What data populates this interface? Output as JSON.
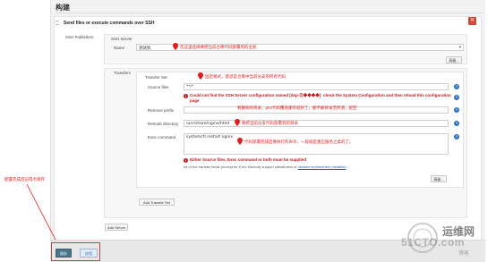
{
  "section": {
    "title": "构建"
  },
  "step": {
    "title": "Send files or execute commands over SSH",
    "close": "✕",
    "publishers_label": "SSH Publishers"
  },
  "ssh_server": {
    "header": "SSH Server",
    "name_label": "Name",
    "name_value": "测试机",
    "advanced": "高级..."
  },
  "transfers": {
    "label": "Transfers",
    "set_header": "Transfer Set",
    "source_files": {
      "label": "Source files",
      "value": "**/*"
    },
    "error_config": "Could not find the SSH Server configuration named [dsp-云◆◆◆◆]- check the System Configuration and then reload this configuration page",
    "remove_prefix": {
      "label": "Remove prefix",
      "value": ""
    },
    "remote_directory": {
      "label": "Remote directory",
      "value": "/usr/share/nginx/html"
    },
    "exec_command": {
      "label": "Exec command",
      "value": "systemctl restart nginx"
    },
    "error_either": "Either Source files, Exec command or both must be supplied",
    "note_prefix": "All of the transfer fields (except for Exec timeout) support substitution of",
    "note_link": "Jenkins environment variables",
    "advanced": "高级...",
    "add_transfer_set": "Add Transfer Set",
    "add_server": "Add Server"
  },
  "annotations": {
    "server": "在这里选择要把当前仓库代码部署到的主机",
    "source": "固定格式，意思是仓库中当前分支的所有代码",
    "prefix": "要删除的目录，pho代码覆盖都有就好了，删不删目录无所谓，留空",
    "remote": "要把当前分支代码部署到的目录",
    "exec": "代码部署完成后要执行的命令，一般就是重启服务之类的了。",
    "save": "配置完成后记得点保存"
  },
  "buttons": {
    "save": "保存",
    "apply": "应用"
  },
  "watermark": {
    "line1": "运维网",
    "line2": "51CTO.com",
    "line3": "博客"
  },
  "colors": {
    "annotation": "#e02020",
    "error": "#c4161c",
    "save": "#4b758b",
    "link": "#1a5fb4"
  }
}
